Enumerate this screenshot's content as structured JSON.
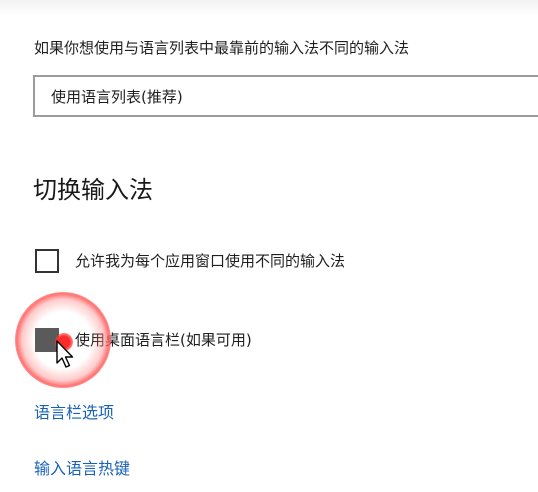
{
  "input_override": {
    "description": "如果你想使用与语言列表中最靠前的输入法不同的输入法",
    "dropdown_value": "使用语言列表(推荐)"
  },
  "switch_input": {
    "title": "切换输入法",
    "options": [
      {
        "label": "允许我为每个应用窗口使用不同的输入法",
        "checked": false
      },
      {
        "label": "使用桌面语言栏(如果可用)",
        "checked": false,
        "pressed": true
      }
    ]
  },
  "links": {
    "language_bar_options": "语言栏选项",
    "input_language_hotkeys": "输入语言热键"
  },
  "icons": {
    "cursor": "mouse-pointer-icon",
    "click_indicator": "click-ripple-icon"
  },
  "colors": {
    "link": "#1a62b8",
    "pressed_checkbox": "#5a5a5a",
    "click_highlight": "#ff3a3a"
  }
}
